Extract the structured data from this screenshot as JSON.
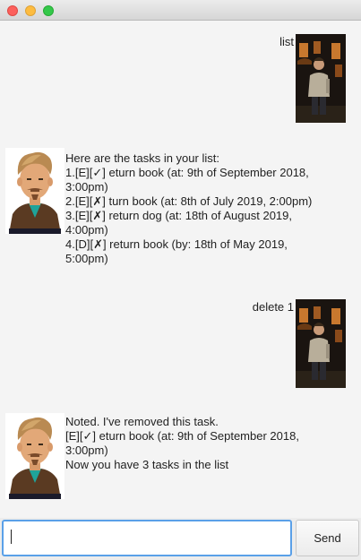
{
  "window": {
    "traffic_lights": [
      "close",
      "minimize",
      "zoom"
    ]
  },
  "messages": [
    {
      "sender": "user",
      "text": "list"
    },
    {
      "sender": "duke",
      "text": "Here are the tasks in your list:\n1.[E][✓] eturn book (at: 9th of September 2018,\n3:00pm)\n2.[E][✗] turn book (at: 8th of July 2019, 2:00pm)\n3.[E][✗] return dog (at: 18th of August 2019,\n4:00pm)\n4.[D][✗] return book (by: 18th of May 2019,\n5:00pm)"
    },
    {
      "sender": "user",
      "text": "delete 1"
    },
    {
      "sender": "duke",
      "text": "Noted. I've removed this task.\n[E][✓] eturn book (at: 9th of September 2018,\n3:00pm)\nNow you have 3 tasks in the list"
    }
  ],
  "input": {
    "value": "",
    "placeholder": ""
  },
  "send_button": {
    "label": "Send"
  },
  "colors": {
    "input_focus_border": "#5aa0e8",
    "chat_background": "#f4f4f4",
    "close": "#fc605c",
    "minimize": "#fdbc40",
    "zoom": "#34c84a"
  }
}
